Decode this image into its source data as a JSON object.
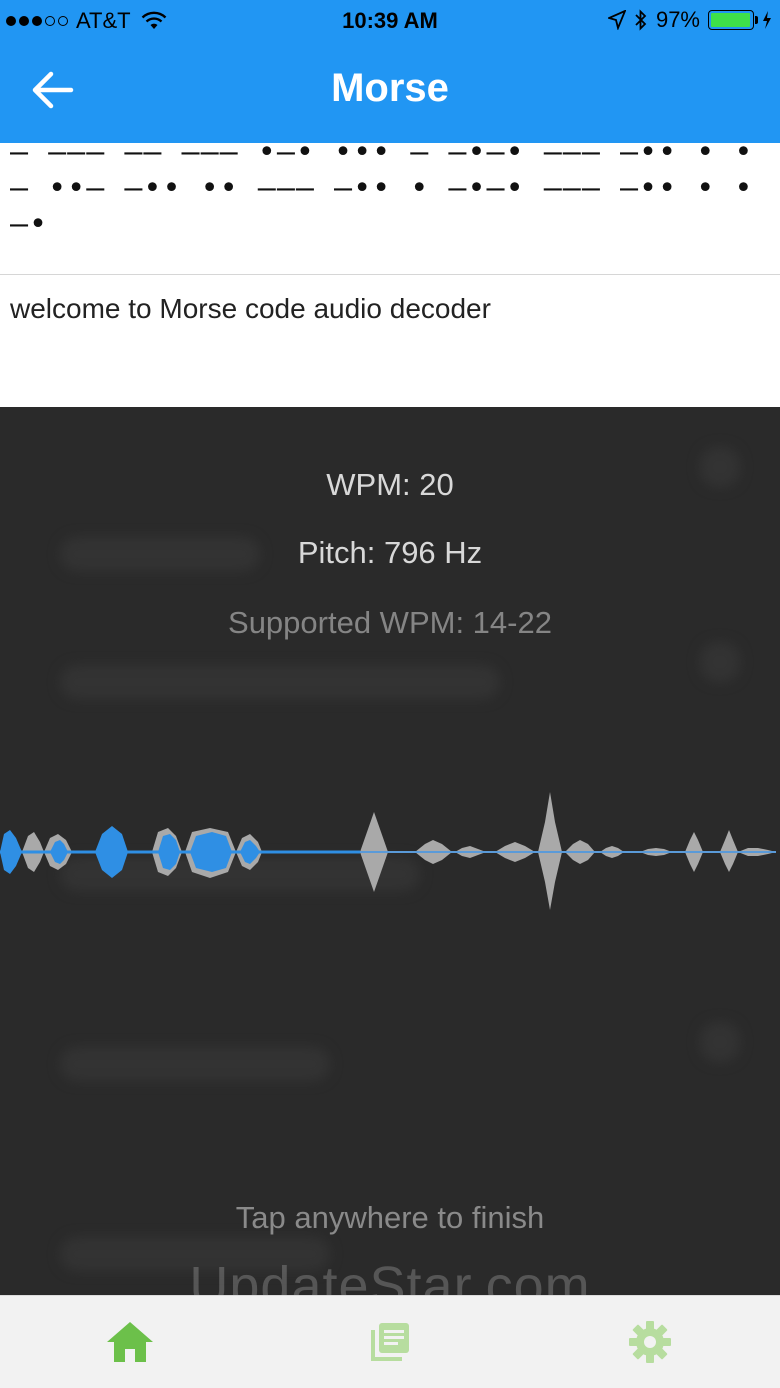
{
  "status_bar": {
    "carrier": "AT&T",
    "time": "10:39 AM",
    "battery": "97%",
    "battery_level": 0.97
  },
  "nav": {
    "title": "Morse",
    "back_icon": "back-arrow-icon"
  },
  "morse": {
    "code": "— ——— —— ——— •—• ••• — —•—• ——— —•• • •— ••— —•• •• ——— —•• • —•—• ——— —•• • •—•"
  },
  "decoded": {
    "text": "welcome to Morse code audio decoder"
  },
  "overlay": {
    "wpm": "WPM: 20",
    "pitch": "Pitch: 796 Hz",
    "supported": "Supported WPM: 14-22",
    "tap_hint": "Tap anywhere to finish"
  },
  "watermark": "UpdateStar.com",
  "tabs": [
    {
      "name": "home",
      "icon": "home-icon",
      "active": true
    },
    {
      "name": "history",
      "icon": "list-icon",
      "active": false
    },
    {
      "name": "settings",
      "icon": "gear-icon",
      "active": false
    }
  ],
  "colors": {
    "primary": "#2196f3",
    "wave_active": "#2f8fe4",
    "wave_inactive": "#a9a9a9",
    "tab_active": "#6cc04a",
    "tab_inactive": "#b7dd9f"
  }
}
